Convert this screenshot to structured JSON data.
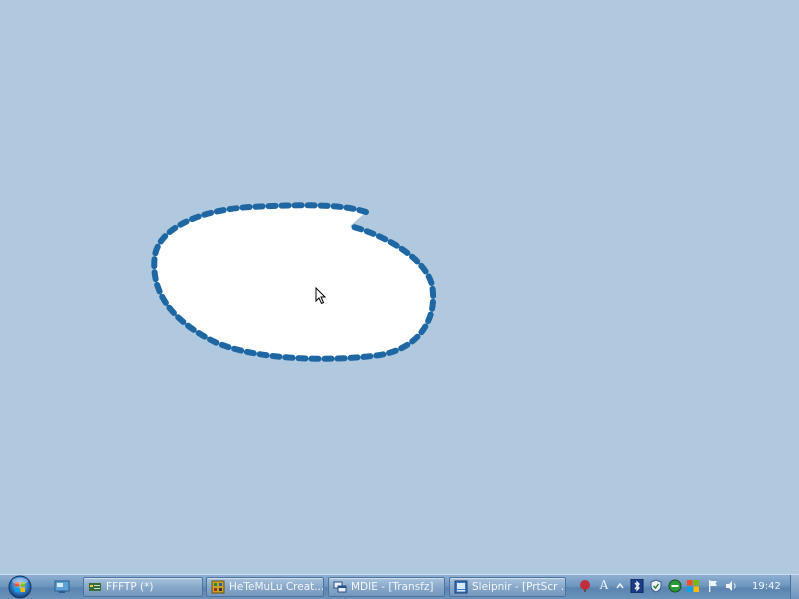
{
  "desktop": {
    "background_color": "#b1c9de",
    "selection_shape": {
      "fill": "#ffffff",
      "stroke": "#1f67a3",
      "style": "dashed-freeform"
    }
  },
  "taskbar": {
    "start_icon": "windows-orb-icon",
    "quick_launch": [
      {
        "icon": "show-desktop-icon"
      }
    ],
    "buttons": [
      {
        "label": "FFFTP (*)",
        "icon": "ffftp-icon"
      },
      {
        "label": "HeTeMuLu Creat...",
        "icon": "hetemulu-icon"
      },
      {
        "label": "MDIE - [Transfz]",
        "icon": "mdie-icon"
      },
      {
        "label": "Sleipnir - [PrtScr ...",
        "icon": "sleipnir-icon"
      }
    ],
    "tray": {
      "icons": [
        "network-red-icon",
        "ime-icon",
        "chevron-up-icon",
        "bluetooth-icon",
        "security-shield-icon",
        "no-entry-icon",
        "windows-flag-icon",
        "action-center-flag-icon",
        "volume-icon"
      ],
      "ime_label": "A",
      "clock": "19:42"
    }
  }
}
